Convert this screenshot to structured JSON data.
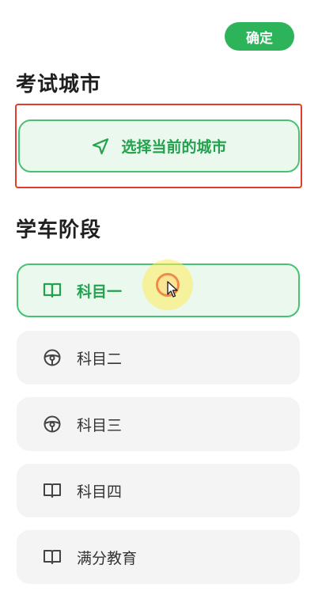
{
  "header": {
    "confirm_label": "确定"
  },
  "city_section": {
    "title": "考试城市",
    "select_button_label": "选择当前的城市",
    "select_button_icon": "navigation-arrow-icon"
  },
  "stage_section": {
    "title": "学车阶段",
    "items": [
      {
        "label": "科目一",
        "icon": "book-icon",
        "selected": true
      },
      {
        "label": "科目二",
        "icon": "steering-wheel-icon",
        "selected": false
      },
      {
        "label": "科目三",
        "icon": "steering-wheel-icon",
        "selected": false
      },
      {
        "label": "科目四",
        "icon": "book-icon",
        "selected": false
      },
      {
        "label": "满分教育",
        "icon": "book-icon",
        "selected": false
      }
    ]
  },
  "colors": {
    "accent": "#2db35a",
    "selected_bg": "#eaf8ee",
    "highlight_border": "#e03c30",
    "item_bg": "#f4f4f4"
  }
}
